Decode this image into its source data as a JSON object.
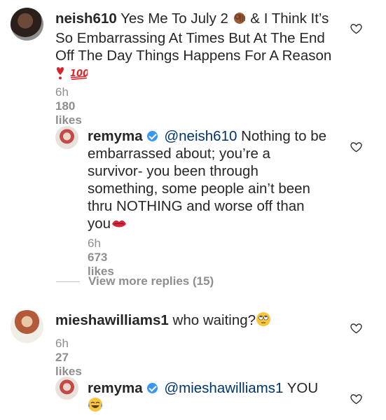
{
  "comments": [
    {
      "username": "neish610",
      "text_lines": [
        "Yes Me To July 2",
        "& I Think It’s So Embarrassing At Times But At The End Off The Day Things Happens For A Reason"
      ],
      "time": "6h",
      "likes": "180 likes"
    },
    {
      "username": "remyma",
      "mention": "@neish610",
      "text": "Nothing to be embarrassed about; you’re a survivor- you been through something, some people ain’t been thru NOTHING and worse off than you",
      "time": "6h",
      "likes": "673 likes"
    },
    {
      "view_more": "View more replies (15)"
    },
    {
      "username": "mieshawilliams1",
      "text": "who waiting?",
      "time": "6h",
      "likes": "27 likes"
    },
    {
      "username": "remyma",
      "mention": "@mieshawilliams1",
      "text": "YOU"
    }
  ],
  "icons": {
    "ok_hand": "ok-hand-emoji",
    "heart_exclamation": "heart-exclamation-emoji",
    "hundred": "hundred-points-emoji",
    "kiss": "kiss-mark-emoji",
    "rolling_eyes": "face-with-rolling-eyes-emoji",
    "tears_of_joy": "face-with-tears-of-joy-emoji",
    "like": "heart-outline-icon",
    "verified": "verified-badge-icon"
  },
  "colors": {
    "text": "#262626",
    "secondary": "#8e8e8e",
    "mention": "#003569",
    "verified": "#3897f0"
  }
}
